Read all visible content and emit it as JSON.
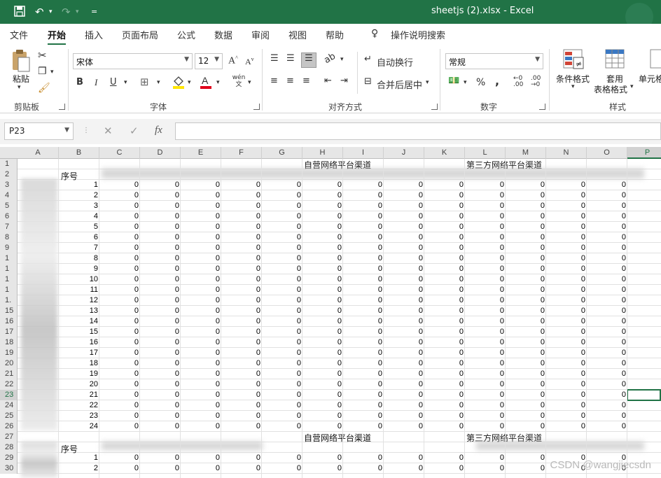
{
  "titlebar": {
    "title": "sheetjs (2).xlsx  -  Excel",
    "save_icon": "save-icon",
    "undo_icon": "undo-icon",
    "redo_icon": "redo-icon",
    "customize_icon": "customize-icon"
  },
  "tabs": [
    "文件",
    "开始",
    "插入",
    "页面布局",
    "公式",
    "数据",
    "审阅",
    "视图",
    "帮助"
  ],
  "tell_me": "操作说明搜索",
  "ribbon": {
    "clipboard": {
      "paste": "粘贴",
      "label": "剪贴板"
    },
    "font": {
      "name": "宋体",
      "size": "12",
      "label": "字体",
      "bold": "B",
      "italic": "I",
      "underline": "U",
      "grow": "A",
      "shrink": "A",
      "phonetic": "wén 文"
    },
    "alignment": {
      "wrap": "自动换行",
      "merge": "合并后居中",
      "label": "对齐方式"
    },
    "number": {
      "format": "常规",
      "percent": "%",
      "comma": ",",
      "inc_dec": ".00",
      "dec_dec": ".00",
      "label": "数字"
    },
    "styles": {
      "conditional": "条件格式",
      "table_format_1": "套用",
      "table_format_2": "表格格式",
      "cell_styles": "单元格",
      "label": "样式"
    }
  },
  "formula_bar": {
    "name_box": "P23",
    "cancel": "✕",
    "enter": "✓",
    "fx": "fx",
    "content": ""
  },
  "columns": [
    "A",
    "B",
    "C",
    "D",
    "E",
    "F",
    "G",
    "H",
    "I",
    "J",
    "K",
    "L",
    "M",
    "N",
    "O",
    "P"
  ],
  "selected_column": "P",
  "selected_row": "23",
  "header_row": {
    "group1": "自营网络平台渠道",
    "group2": "第三方网络平台渠道",
    "seq_label": "序号"
  },
  "rows": [
    {
      "n": "1",
      "seq": ""
    },
    {
      "n": "2",
      "seq": "序号"
    },
    {
      "n": "3",
      "seq": "1"
    },
    {
      "n": "4",
      "seq": "2"
    },
    {
      "n": "5",
      "seq": "3"
    },
    {
      "n": "6",
      "seq": "4"
    },
    {
      "n": "7",
      "seq": "5"
    },
    {
      "n": "8",
      "seq": "6"
    },
    {
      "n": "9",
      "seq": "7"
    },
    {
      "n": "1",
      "seq": "8"
    },
    {
      "n": "1",
      "seq": "9"
    },
    {
      "n": "1",
      "seq": "10"
    },
    {
      "n": "1",
      "seq": "11"
    },
    {
      "n": "1.",
      "seq": "12"
    },
    {
      "n": "15",
      "seq": "13"
    },
    {
      "n": "16",
      "seq": "14"
    },
    {
      "n": "17",
      "seq": "15"
    },
    {
      "n": "18",
      "seq": "16"
    },
    {
      "n": "19",
      "seq": "17"
    },
    {
      "n": "20",
      "seq": "18"
    },
    {
      "n": "21",
      "seq": "19"
    },
    {
      "n": "22",
      "seq": "20"
    },
    {
      "n": "23",
      "seq": "21"
    },
    {
      "n": "24",
      "seq": "22"
    },
    {
      "n": "25",
      "seq": "23"
    },
    {
      "n": "26",
      "seq": "24"
    },
    {
      "n": "27",
      "seq": ""
    },
    {
      "n": "28",
      "seq": "序号"
    },
    {
      "n": "29",
      "seq": "1"
    },
    {
      "n": "30",
      "seq": "2"
    }
  ],
  "zero": "0",
  "watermark": "CSDN @wangjiecsdn"
}
